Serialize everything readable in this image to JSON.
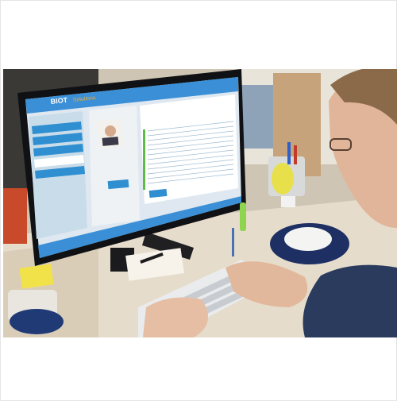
{
  "scene": {
    "description_free": true,
    "monitor_app": {
      "logo_text": "BIOT",
      "logo_accent": "Solutions",
      "accent_color": "#2f8fd0",
      "header_color": "#3a8fd6"
    },
    "colors": {
      "desk": "#e7ddcb",
      "wall": "#d6cfc2",
      "mousepad": "#1d2f63",
      "sleeve": "#2a3b5e"
    }
  }
}
